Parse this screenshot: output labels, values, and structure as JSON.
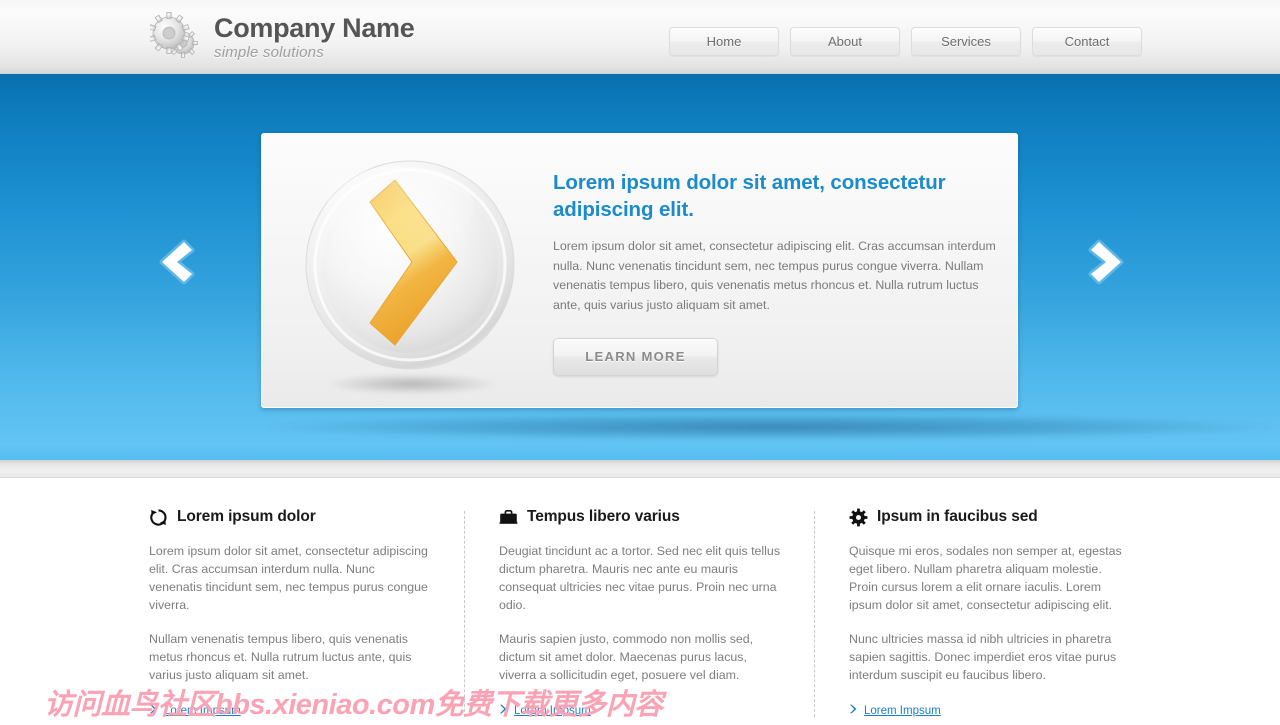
{
  "header": {
    "brand_name": "Company Name",
    "brand_tagline": "simple solutions",
    "logo_icon": "gears-icon",
    "nav": [
      {
        "label": "Home",
        "name": "nav-home"
      },
      {
        "label": "About",
        "name": "nav-about"
      },
      {
        "label": "Services",
        "name": "nav-services"
      },
      {
        "label": "Contact",
        "name": "nav-contact"
      }
    ]
  },
  "hero": {
    "heading": "Lorem ipsum dolor sit amet, consectetur adipiscing elit.",
    "paragraph": "Lorem ipsum dolor sit amet, consectetur adipiscing elit. Cras accumsan interdum nulla. Nunc venenatis tincidunt sem, nec tempus purus congue viverra. Nullam venenatis tempus libero, quis venenatis metus rhoncus et. Nulla rutrum luctus ante, quis varius justo aliquam sit amet.",
    "cta_label": "LEARN MORE",
    "visual_icon": "chevron-sphere-icon",
    "prev_icon": "chevron-left-icon",
    "next_icon": "chevron-right-icon",
    "heading_color": "#1b8bcb",
    "band_color_top": "#0a6fae",
    "band_color_bottom": "#62c4f4"
  },
  "columns": [
    {
      "icon": "refresh-circle-icon",
      "title": "Lorem ipsum dolor",
      "paragraphs": [
        "Lorem ipsum dolor sit amet, consectetur adipiscing elit. Cras accumsan interdum nulla. Nunc venenatis tincidunt sem, nec tempus purus congue viverra.",
        "Nullam venenatis tempus libero, quis venenatis metus rhoncus et. Nulla rutrum luctus ante, quis varius justo aliquam sit amet."
      ],
      "link_label": "Lorem Impsum"
    },
    {
      "icon": "briefcase-icon",
      "title": "Tempus libero varius",
      "paragraphs": [
        "Deugiat tincidunt ac a tortor. Sed nec elit quis tellus dictum pharetra. Mauris nec ante eu mauris consequat ultricies nec vitae purus. Proin nec urna odio.",
        "Mauris sapien justo, commodo non mollis sed, dictum sit amet dolor. Maecenas purus lacus, viverra a sollicitudin eget, posuere vel diam."
      ],
      "link_label": "Lorem Impsum"
    },
    {
      "icon": "gear-icon",
      "title": "Ipsum in faucibus sed",
      "paragraphs": [
        "Quisque mi eros, sodales non semper at, egestas eget libero. Nullam pharetra aliquam molestie. Proin cursus lorem a elit ornare iaculis. Lorem ipsum dolor sit amet, consectetur adipiscing elit.",
        "Nunc ultricies massa id nibh ultricies in pharetra sapien sagittis. Donec imperdiet eros vitae purus interdum suscipit eu faucibus libero."
      ],
      "link_label": "Lorem Impsum"
    }
  ],
  "watermark": {
    "text": "访问血鸟社区bbs.xieniao.com免费下载更多内容",
    "color": "#fba3b4"
  }
}
